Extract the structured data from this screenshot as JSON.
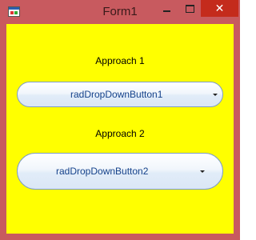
{
  "window": {
    "title": "Form1",
    "icon": "winforms-app-icon",
    "controls": {
      "minimize_icon": "minimize-icon",
      "maximize_icon": "maximize-icon",
      "close_label": "✕"
    }
  },
  "form": {
    "background": "#ffff00",
    "label1": "Approach 1",
    "label2": "Approach 2",
    "dropdown1": {
      "text": "radDropDownButton1",
      "arrow_icon": "dropdown-arrow-icon"
    },
    "dropdown2": {
      "text": "radDropDownButton2",
      "arrow_icon": "dropdown-arrow-icon"
    }
  },
  "colors": {
    "frame": "#c85a5f",
    "close_button": "#c42b1c",
    "button_text": "#15428b",
    "button_border": "#7d9cc6"
  }
}
